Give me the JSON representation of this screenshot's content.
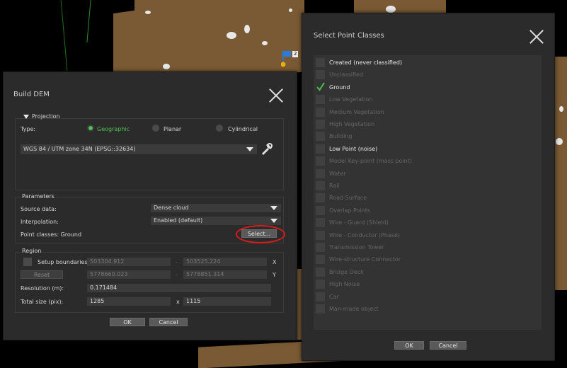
{
  "background": {
    "flag_label": "2"
  },
  "build_dem": {
    "title": "Build DEM",
    "projection": {
      "header": "Projection",
      "type_label": "Type:",
      "options": [
        "Geographic",
        "Planar",
        "Cylindrical"
      ],
      "selected": "Geographic",
      "crs": "WGS 84 / UTM zone 34N (EPSG::32634)"
    },
    "parameters": {
      "header": "Parameters",
      "source_label": "Source data:",
      "source_value": "Dense cloud",
      "interp_label": "Interpolation:",
      "interp_value": "Enabled (default)",
      "classes_label": "Point classes: Ground",
      "select_button": "Select..."
    },
    "region": {
      "header": "Region",
      "setup_label": "Setup boundaries:",
      "reset_button": "Reset",
      "x_min": "503304.912",
      "x_max": "503525.224",
      "y_min": "5778660.023",
      "y_max": "5778851.314",
      "dash": "-",
      "x_axis": "X",
      "y_axis": "Y",
      "resolution_label": "Resolution (m):",
      "resolution_value": "0.171484",
      "size_label": "Total size (pix):",
      "size_w": "1285",
      "size_x": "x",
      "size_h": "1115"
    },
    "ok": "OK",
    "cancel": "Cancel"
  },
  "point_classes": {
    "title": "Select Point Classes",
    "items": [
      {
        "label": "Created (never classified)",
        "on": true,
        "checked": false
      },
      {
        "label": "Unclassified",
        "on": false,
        "checked": false
      },
      {
        "label": "Ground",
        "on": true,
        "checked": true
      },
      {
        "label": "Low Vegetation",
        "on": false,
        "checked": false
      },
      {
        "label": "Medium Vegetation",
        "on": false,
        "checked": false
      },
      {
        "label": "High Vegetation",
        "on": false,
        "checked": false
      },
      {
        "label": "Building",
        "on": false,
        "checked": false
      },
      {
        "label": "Low Point (noise)",
        "on": true,
        "checked": false
      },
      {
        "label": "Model Key-point (mass point)",
        "on": false,
        "checked": false
      },
      {
        "label": "Water",
        "on": false,
        "checked": false
      },
      {
        "label": "Rail",
        "on": false,
        "checked": false
      },
      {
        "label": "Road Surface",
        "on": false,
        "checked": false
      },
      {
        "label": "Overlap Points",
        "on": false,
        "checked": false
      },
      {
        "label": "Wire - Guard (Shield)",
        "on": false,
        "checked": false
      },
      {
        "label": "Wire - Conductor (Phase)",
        "on": false,
        "checked": false
      },
      {
        "label": "Transmission Tower",
        "on": false,
        "checked": false
      },
      {
        "label": "Wire-structure Connector",
        "on": false,
        "checked": false
      },
      {
        "label": "Bridge Deck",
        "on": false,
        "checked": false
      },
      {
        "label": "High Noise",
        "on": false,
        "checked": false
      },
      {
        "label": "Car",
        "on": false,
        "checked": false
      },
      {
        "label": "Man-made object",
        "on": false,
        "checked": false
      }
    ],
    "ok": "OK",
    "cancel": "Cancel"
  },
  "colors": {
    "accent_green": "#4fbf56",
    "highlight_ring": "#d81b1b",
    "terrain": "#7a5a34"
  }
}
